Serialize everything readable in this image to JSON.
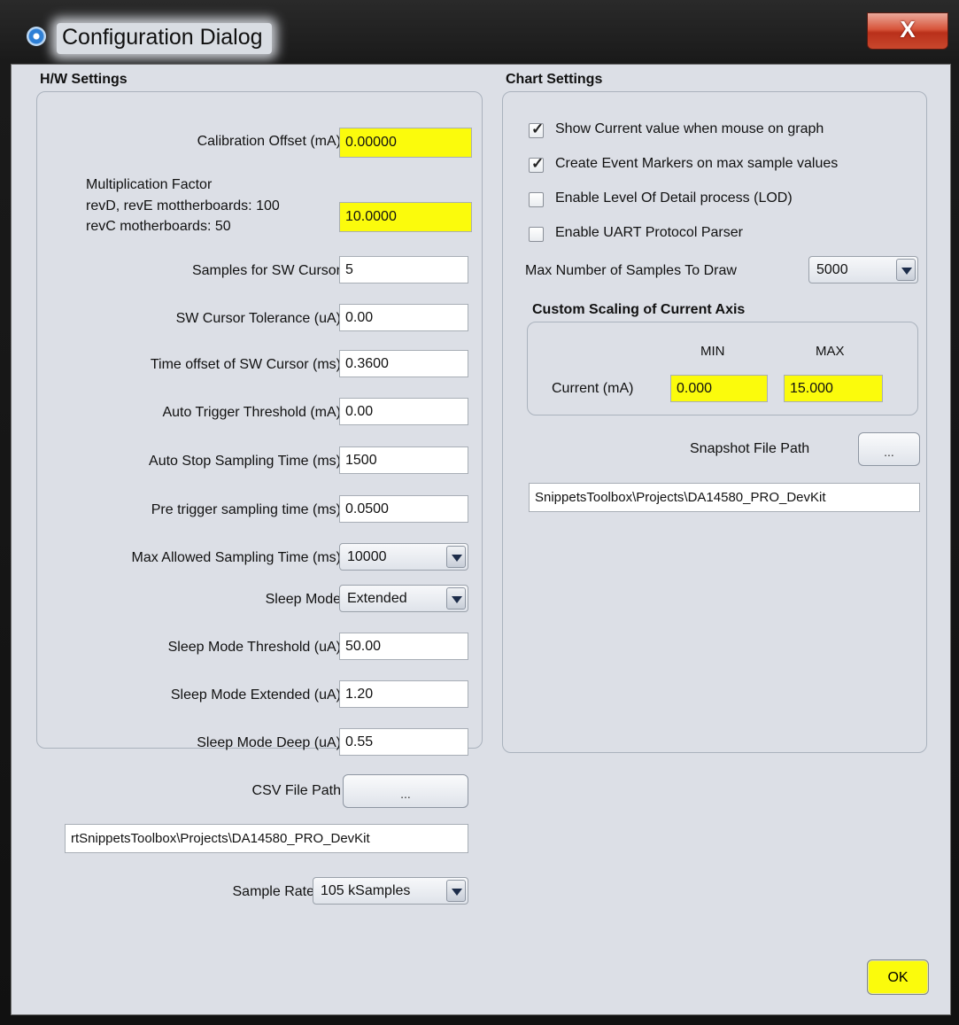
{
  "window": {
    "title": "Configuration Dialog",
    "close_glyph": "X"
  },
  "hw": {
    "title": "H/W Settings",
    "calibration_offset": {
      "label": "Calibration Offset (mA)",
      "value": "0.00000"
    },
    "mult_factor": {
      "line1": "Multiplication Factor",
      "line2": "revD, revE mottherboards: 100",
      "line3": "revC motherboards: 50",
      "value": "10.0000"
    },
    "samples_sw_cursor": {
      "label": "Samples for SW Cursor",
      "value": "5"
    },
    "sw_cursor_tol": {
      "label": "SW Cursor Tolerance (uA)",
      "value": "0.00"
    },
    "time_offset": {
      "label": "Time offset of SW Cursor (ms)",
      "value": "0.3600"
    },
    "auto_trigger": {
      "label": "Auto Trigger Threshold (mA)",
      "value": "0.00"
    },
    "auto_stop": {
      "label": "Auto Stop Sampling Time (ms)",
      "value": "1500"
    },
    "pre_trigger": {
      "label": "Pre trigger sampling time (ms)",
      "value": "0.0500"
    },
    "max_allowed": {
      "label": "Max Allowed Sampling Time (ms)",
      "value": "10000"
    },
    "sleep_mode": {
      "label": "Sleep Mode",
      "value": "Extended"
    },
    "sleep_threshold": {
      "label": "Sleep Mode Threshold (uA)",
      "value": "50.00"
    },
    "sleep_extended": {
      "label": "Sleep Mode Extended (uA)",
      "value": "1.20"
    },
    "sleep_deep": {
      "label": "Sleep Mode Deep (uA)",
      "value": "0.55"
    },
    "csv_path": {
      "label": "CSV File Path",
      "button": "...",
      "value": "rtSnippetsToolbox\\Projects\\DA14580_PRO_DevKit"
    },
    "sample_rate": {
      "label": "Sample Rate",
      "value": "105 kSamples"
    }
  },
  "chart": {
    "title": "Chart Settings",
    "checks": [
      {
        "label": "Show Current value when mouse on graph",
        "checked": true
      },
      {
        "label": "Create Event Markers on max sample values",
        "checked": true
      },
      {
        "label": "Enable Level Of Detail process (LOD)",
        "checked": false
      },
      {
        "label": "Enable UART Protocol Parser",
        "checked": false
      }
    ],
    "max_samples": {
      "label": "Max Number of Samples To Draw",
      "value": "5000"
    },
    "scaling": {
      "title": "Custom Scaling of Current Axis",
      "min_header": "MIN",
      "max_header": "MAX",
      "row_label": "Current (mA)",
      "min": "0.000",
      "max": "15.000"
    },
    "snapshot": {
      "label": "Snapshot File Path",
      "button": "...",
      "value": "SnippetsToolbox\\Projects\\DA14580_PRO_DevKit"
    }
  },
  "ok_label": "OK",
  "colors": {
    "highlight": "#fbfb0c",
    "dialog_bg": "#dcdfe6",
    "close_red": "#c9472c"
  },
  "icons": {
    "app": "app-gear-icon",
    "close": "close-icon",
    "dropdown": "chevron-down-icon",
    "check": "checkmark-icon"
  }
}
